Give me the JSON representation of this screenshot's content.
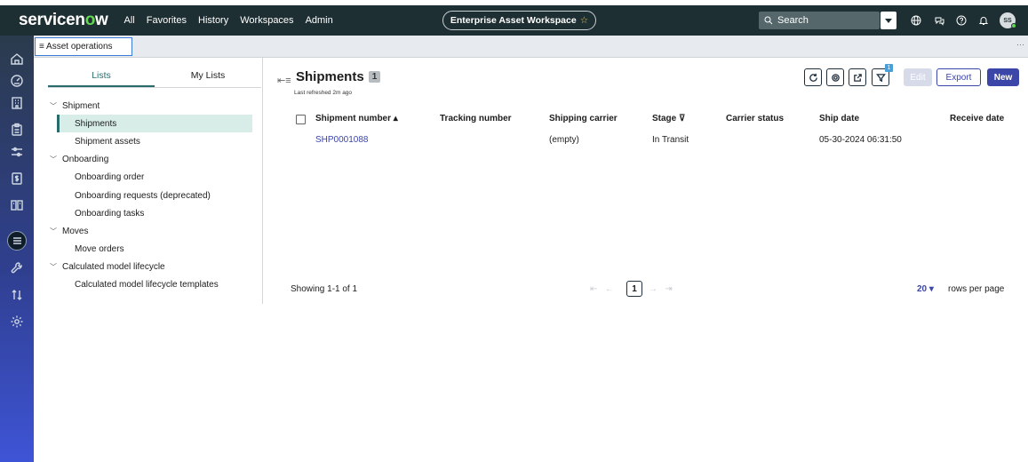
{
  "app": {
    "logo_pre": "servicen",
    "logo_o": "o",
    "logo_post": "w"
  },
  "nav": [
    "All",
    "Favorites",
    "History",
    "Workspaces",
    "Admin"
  ],
  "workspace": {
    "label": "Enterprise Asset Workspace",
    "star": "☆"
  },
  "search": {
    "placeholder": "Search"
  },
  "user": {
    "initials": "SS"
  },
  "top_icons": [
    "globe-icon",
    "chat-icon",
    "help-icon",
    "bell-icon"
  ],
  "rail_icons": [
    "home-icon",
    "dashboard-icon",
    "building-icon",
    "clipboard-icon",
    "sliders-icon",
    "invoice-icon",
    "book-icon",
    "list-icon",
    "wrench-icon",
    "sort-arrows-icon",
    "gear-icon"
  ],
  "operations_tab": {
    "label": "≡ Asset operations",
    "more": "···"
  },
  "left_tabs": [
    "Lists",
    "My Lists"
  ],
  "tree": [
    {
      "group": "Shipment",
      "items": [
        "Shipments",
        "Shipment assets"
      ]
    },
    {
      "group": "Onboarding",
      "items": [
        "Onboarding order",
        "Onboarding requests (deprecated)",
        "Onboarding tasks"
      ]
    },
    {
      "group": "Moves",
      "items": [
        "Move orders"
      ]
    },
    {
      "group": "Calculated model lifecycle",
      "items": [
        "Calculated model lifecycle templates"
      ]
    }
  ],
  "list": {
    "title": "Shipments",
    "count": "1",
    "refreshed": "Last refreshed 2m ago",
    "filter_count": "1",
    "edit_label": "Edit",
    "export_label": "Export",
    "new_label": "New",
    "columns": [
      "Shipment number ▴",
      "Tracking number",
      "Shipping carrier",
      "Stage ⊽",
      "Carrier status",
      "Ship date",
      "Receive date"
    ],
    "rows": [
      {
        "number": "SHP0001088",
        "tracking": "",
        "carrier": "(empty)",
        "stage": "In Transit",
        "carrier_status": "",
        "ship_date": "05-30-2024 06:31:50",
        "receive_date": ""
      }
    ]
  },
  "pager": {
    "showing": "Showing 1-1 of 1",
    "page": "1",
    "rows_per_page": "20 ▾",
    "rows_label": "rows per page",
    "first": "⇤",
    "prev": "←",
    "next": "→",
    "last": "⇥"
  }
}
